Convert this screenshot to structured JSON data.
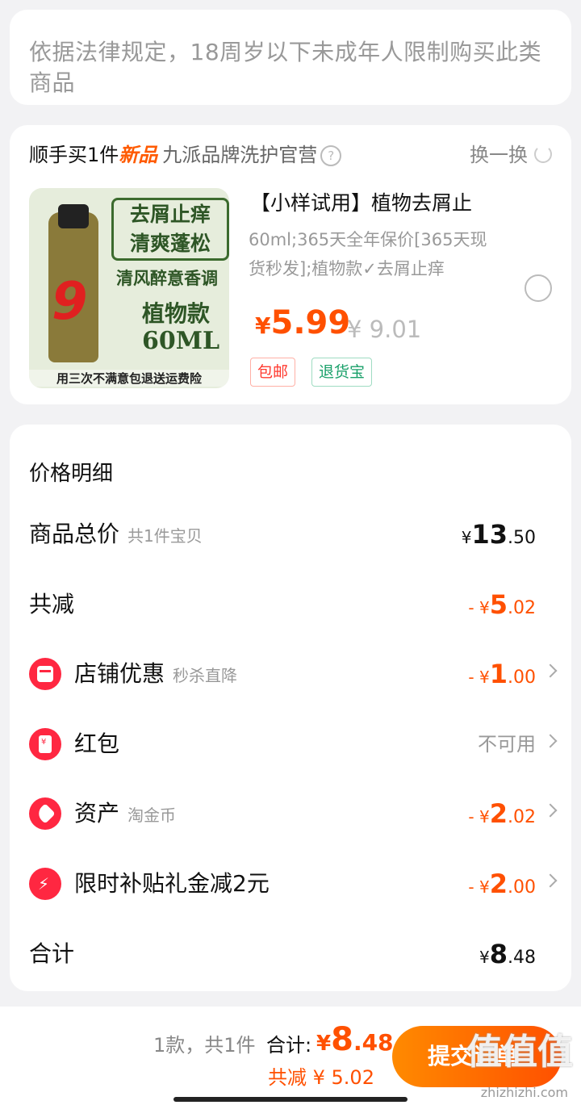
{
  "notice": {
    "text": "依据法律规定，18周岁以下未成年人限制购买此类商品"
  },
  "add_on": {
    "head_prefix": "顺手买1件",
    "head_new": "新品",
    "shop_name": "九派品牌洗护官营",
    "swap_label": "换一换",
    "product": {
      "title": "【小样试用】植物去屑止",
      "spec": "60ml;365天全年保价[365天现货秒发];植物款✓去屑止痒",
      "price_currency": "¥",
      "price": "5.99",
      "original_price": "¥ 9.01",
      "tags": [
        "包邮",
        "退货宝"
      ],
      "image_text": {
        "badge": "去屑止痒\n清爽蓬松",
        "line1": "清风醉意香调",
        "line2": "植物款",
        "line3": "60ML",
        "footer": "用三次不满意包退送运费险",
        "logo_num": "9"
      }
    }
  },
  "price_detail": {
    "title": "价格明细",
    "rows": [
      {
        "label": "商品总价",
        "sub": "共1件宝贝",
        "y": "¥",
        "big": "13",
        "sm": ".50",
        "type": "normal"
      },
      {
        "label": "共减",
        "sub": "",
        "y": "- ¥",
        "big": "5",
        "sm": ".02",
        "type": "red"
      },
      {
        "label": "店铺优惠",
        "sub": "秒杀直降",
        "y": "- ¥",
        "big": "1",
        "sm": ".00",
        "type": "red",
        "icon": "shop-icon"
      },
      {
        "label": "红包",
        "sub": "",
        "text": "不可用",
        "type": "gray",
        "icon": "red-envelope-icon"
      },
      {
        "label": "资产",
        "sub": "淘金币",
        "y": "- ¥",
        "big": "2",
        "sm": ".02",
        "type": "red",
        "icon": "tag-icon"
      },
      {
        "label": "限时补贴礼金减2元",
        "sub": "",
        "y": "- ¥",
        "big": "2",
        "sm": ".00",
        "type": "red",
        "icon": "bolt-icon"
      },
      {
        "label": "合计",
        "sub": "",
        "y": "¥",
        "big": "8",
        "sm": ".48",
        "type": "normal"
      }
    ]
  },
  "bottom": {
    "count": "1款，共1件",
    "total_label": "合计:",
    "total_y": "¥",
    "total_big": "8",
    "total_sm": ".48",
    "saved": "共减 ¥ 5.02",
    "submit": "提交订单",
    "watermark": "值值值",
    "watermark_url": "zhizhizhi.com"
  },
  "colors": {
    "accent": "#ff5000",
    "icon_red": "#ff2741",
    "tag_green": "#1aa06a"
  }
}
